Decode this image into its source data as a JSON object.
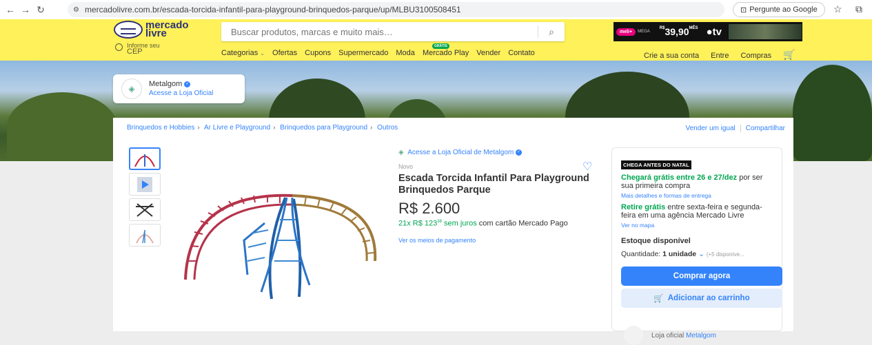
{
  "browser": {
    "url": "mercadolivre.com.br/escada-torcida-infantil-para-playground-brinquedos-parque/up/MLBU3100508451",
    "google_button": "Pergunte ao Google"
  },
  "header": {
    "logo_line1": "mercado",
    "logo_line2": "livre",
    "cep_line1": "Informe seu",
    "cep_line2": "CEP",
    "search_placeholder": "Buscar produtos, marcas e muito mais…",
    "promo": {
      "badge": "meli+",
      "badge_sub": "MEGA",
      "price_prefix": "R$",
      "price": "39,90",
      "price_suffix": "MÊS",
      "tv": "tv"
    },
    "nav": [
      "Categorias",
      "Ofertas",
      "Cupons",
      "Supermercado",
      "Moda",
      "Mercado Play",
      "Vender",
      "Contato"
    ],
    "gratis_badge": "GRÁTIS",
    "account": [
      "Crie a sua conta",
      "Entre",
      "Compras"
    ]
  },
  "store": {
    "name": "Metalgom",
    "link": "Acesse a Loja Oficial"
  },
  "breadcrumbs": [
    "Brinquedos e Hobbies",
    "Ar Livre e Playground",
    "Brinquedos para Playground",
    "Outros"
  ],
  "share_links": [
    "Vender um igual",
    "Compartilhar"
  ],
  "product": {
    "official_link": "Acesse a Loja Oficial de Metalgom",
    "condition": "Novo",
    "title": "Escada Torcida Infantil Para Playground Brinquedos Parque",
    "price": "R$ 2.600",
    "installments_green": "21x R$ 123",
    "installments_cents": "38",
    "installments_green2": " sem juros",
    "installments_rest": " com cartão Mercado Pago",
    "payment_link": "Ver os meios de pagamento"
  },
  "buybox": {
    "badge": "CHEGA ANTES DO NATAL",
    "ship_green": "Chegará grátis entre 26 e 27/dez",
    "ship_rest": " por ser sua primeira compra",
    "ship_link": "Mais detalhes e formas de entrega",
    "pickup_green": "Retire grátis",
    "pickup_rest": " entre sexta-feira e segunda-feira em uma agência Mercado Livre",
    "map_link": "Ver no mapa",
    "stock": "Estoque disponível",
    "qty_label": "Quantidade: ",
    "qty_value": "1 unidade",
    "qty_more": "(+5 disponíve...",
    "buy_button": "Comprar agora",
    "cart_button": "Adicionar ao carrinho",
    "seller_prefix": "Loja oficial",
    "seller_name": "Metalgom"
  },
  "colors": {
    "header_yellow": "#fff159",
    "accent_blue": "#3483fa",
    "green": "#00a650"
  }
}
